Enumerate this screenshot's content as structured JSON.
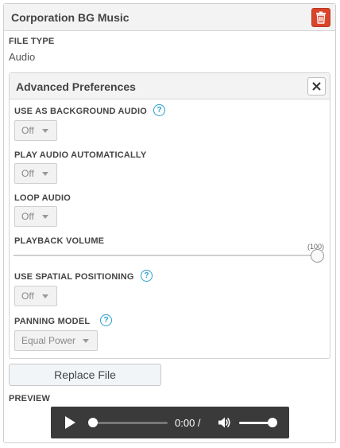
{
  "panel": {
    "title": "Corporation BG Music"
  },
  "file_type": {
    "label": "FILE TYPE",
    "value": "Audio"
  },
  "advanced": {
    "title": "Advanced Preferences",
    "background_audio": {
      "label": "USE AS BACKGROUND AUDIO",
      "value": "Off"
    },
    "autoplay": {
      "label": "PLAY AUDIO AUTOMATICALLY",
      "value": "Off"
    },
    "loop": {
      "label": "LOOP AUDIO",
      "value": "Off"
    },
    "volume": {
      "label": "PLAYBACK VOLUME",
      "value_label": "(100)",
      "value": 100
    },
    "spatial": {
      "label": "USE SPATIAL POSITIONING",
      "value": "Off"
    },
    "panning": {
      "label": "PANNING MODEL",
      "value": "Equal Power"
    }
  },
  "replace_button": {
    "label": "Replace File"
  },
  "preview": {
    "label": "PREVIEW",
    "time": "0:00 /",
    "playback_progress": 0.0,
    "volume_level": 1.0
  },
  "icons": {
    "delete": "trash-icon",
    "close": "close-icon",
    "help": "help-circle-icon",
    "play": "play-icon",
    "volume": "volume-icon"
  },
  "colors": {
    "danger": "#d9452b",
    "help": "#2a9fd0",
    "player_bg": "#3a3a3a"
  }
}
